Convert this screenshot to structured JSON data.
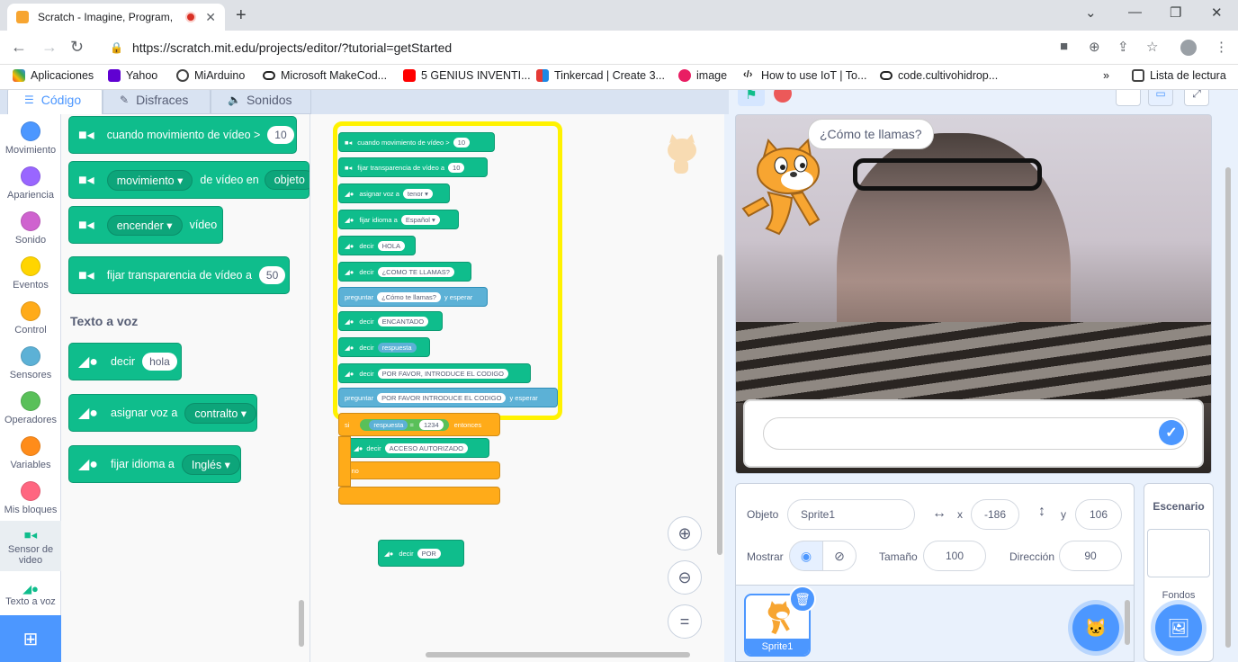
{
  "browser": {
    "tab_title": "Scratch - Imagine, Program,",
    "url": "https://scratch.mit.edu/projects/editor/?tutorial=getStarted",
    "bookmarks": [
      "Aplicaciones",
      "Yahoo",
      "MiArduino",
      "Microsoft MakeCod...",
      "5 GENIUS INVENTI...",
      "Tinkercad | Create 3...",
      "image",
      "How to use IoT | To...",
      "code.cultivohidrop..."
    ],
    "reading_list": "Lista de lectura"
  },
  "editor_tabs": [
    "Código",
    "Disfraces",
    "Sonidos"
  ],
  "categories": [
    {
      "label": "Movimiento",
      "color": "#4c97ff"
    },
    {
      "label": "Apariencia",
      "color": "#9966ff"
    },
    {
      "label": "Sonido",
      "color": "#cf63cf"
    },
    {
      "label": "Eventos",
      "color": "#ffd500"
    },
    {
      "label": "Control",
      "color": "#ffab19"
    },
    {
      "label": "Sensores",
      "color": "#5cb1d6"
    },
    {
      "label": "Operadores",
      "color": "#59c059"
    },
    {
      "label": "Variables",
      "color": "#ff8c1a"
    },
    {
      "label": "Mis bloques",
      "color": "#ff6680"
    },
    {
      "label": "Sensor de video"
    },
    {
      "label": "Texto a voz"
    }
  ],
  "palette": {
    "video_blocks": {
      "when_motion": "cuando movimiento de vídeo >",
      "when_motion_value": "10",
      "motion_drop": "movimiento",
      "motion_on": "de vídeo en",
      "motion_target": "objeto",
      "turn_drop": "encender",
      "turn_suffix": "vídeo",
      "transparency": "fijar transparencia de vídeo a",
      "transparency_value": "50"
    },
    "tts_section": "Texto a voz",
    "tts_blocks": {
      "say": "decir",
      "say_value": "hola",
      "voice": "asignar voz a",
      "voice_drop": "contralto",
      "language": "fijar idioma a",
      "language_drop": "Inglés"
    }
  },
  "script": [
    {
      "text": "cuando movimiento de vídeo >",
      "value": "10"
    },
    {
      "text": "fijar transparencia de vídeo a",
      "value": "10"
    },
    {
      "text": "asignar voz a",
      "value": "tenor ▾"
    },
    {
      "text": "fijar idioma a",
      "value": "Español ▾"
    },
    {
      "text": "decir",
      "value": "HOLA"
    },
    {
      "text": "decir",
      "value": "¿COMO TE LLAMAS?"
    },
    {
      "text": "preguntar",
      "value": "¿Cómo te llamas?",
      "suffix": "y esperar",
      "kind": "sense"
    },
    {
      "text": "decir",
      "value": "ENCANTADO"
    },
    {
      "text": "decir",
      "value": "respuesta",
      "kind": "sense-reporter"
    },
    {
      "text": "decir",
      "value": "POR FAVOR, INTRODUCE EL CODIGO"
    },
    {
      "text": "preguntar",
      "value": "POR FAVOR INTRODUCE EL CODIGO",
      "suffix": "y esperar",
      "kind": "sense"
    }
  ],
  "if_block": {
    "label_if": "si",
    "cond_left": "respuesta",
    "cond_op": "=",
    "cond_right": "1234",
    "label_then": "entonces",
    "inner_text": "decir",
    "inner_value": "ACCESO AUTORIZADO",
    "label_else": "si no"
  },
  "loose_block": {
    "text": "decir",
    "value": "POR"
  },
  "stage": {
    "bubble": "¿Cómo te llamas?"
  },
  "sprite_info": {
    "object_label": "Objeto",
    "object_name": "Sprite1",
    "x_label": "x",
    "x_value": "-186",
    "y_label": "y",
    "y_value": "106",
    "show_label": "Mostrar",
    "size_label": "Tamaño",
    "size_value": "100",
    "direction_label": "Dirección",
    "direction_value": "90"
  },
  "sprite_list": [
    {
      "name": "Sprite1"
    }
  ],
  "stage_pane": {
    "title": "Escenario",
    "backdrops": "Fondos"
  }
}
